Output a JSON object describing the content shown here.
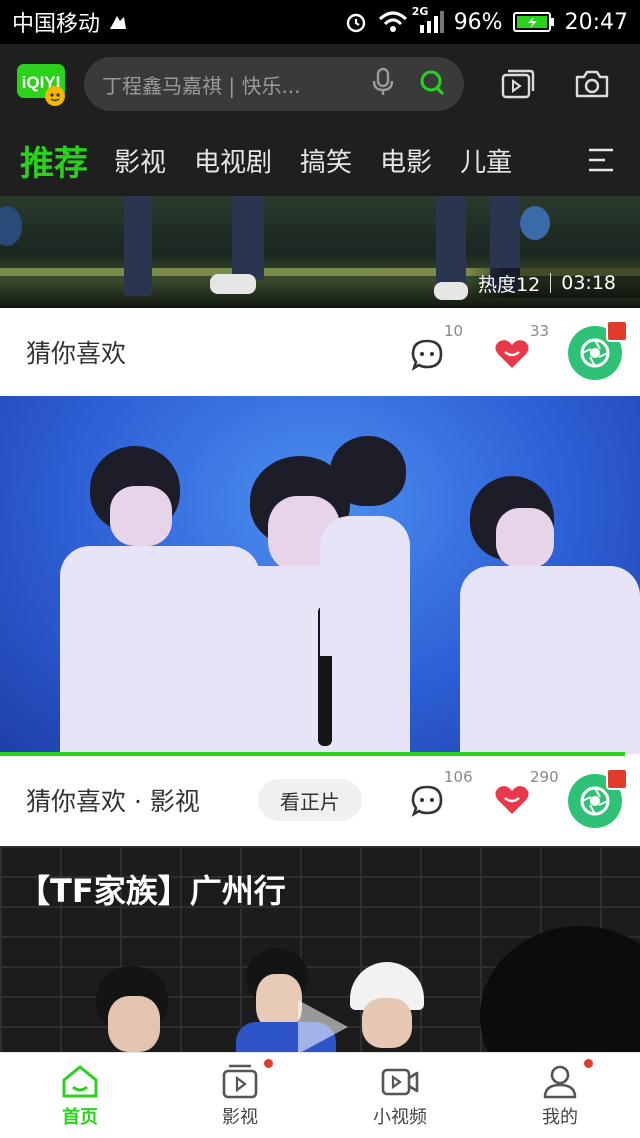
{
  "status_bar": {
    "carrier": "中国移动",
    "network": "2G",
    "battery": "96%",
    "time": "20:47"
  },
  "header": {
    "logo_text": "iQIYI",
    "search_placeholder": "丁程鑫马嘉祺 | 快乐...",
    "icons": [
      "mic-icon",
      "search-icon",
      "playlist-icon",
      "camera-icon"
    ]
  },
  "tabs": {
    "items": [
      "推荐",
      "影视",
      "电视剧",
      "搞笑",
      "电影",
      "儿童"
    ],
    "active_index": 0
  },
  "feed": {
    "item1": {
      "heat": "热度12",
      "duration": "03:18",
      "label": "猜你喜欢",
      "comments": "10",
      "likes": "33"
    },
    "item2": {
      "label": "猜你喜欢 · 影视",
      "watch_button": "看正片",
      "comments": "106",
      "likes": "290"
    },
    "item3": {
      "title": "【TF家族】广州行"
    }
  },
  "bottom_nav": {
    "items": [
      {
        "label": "首页",
        "active": true,
        "dot": false
      },
      {
        "label": "影视",
        "active": false,
        "dot": true
      },
      {
        "label": "小视频",
        "active": false,
        "dot": false
      },
      {
        "label": "我的",
        "active": false,
        "dot": true
      }
    ]
  },
  "colors": {
    "accent": "#2ad21c",
    "header_bg": "#1f1f1f",
    "like": "#e8394a",
    "avatar": "#2fc277"
  }
}
